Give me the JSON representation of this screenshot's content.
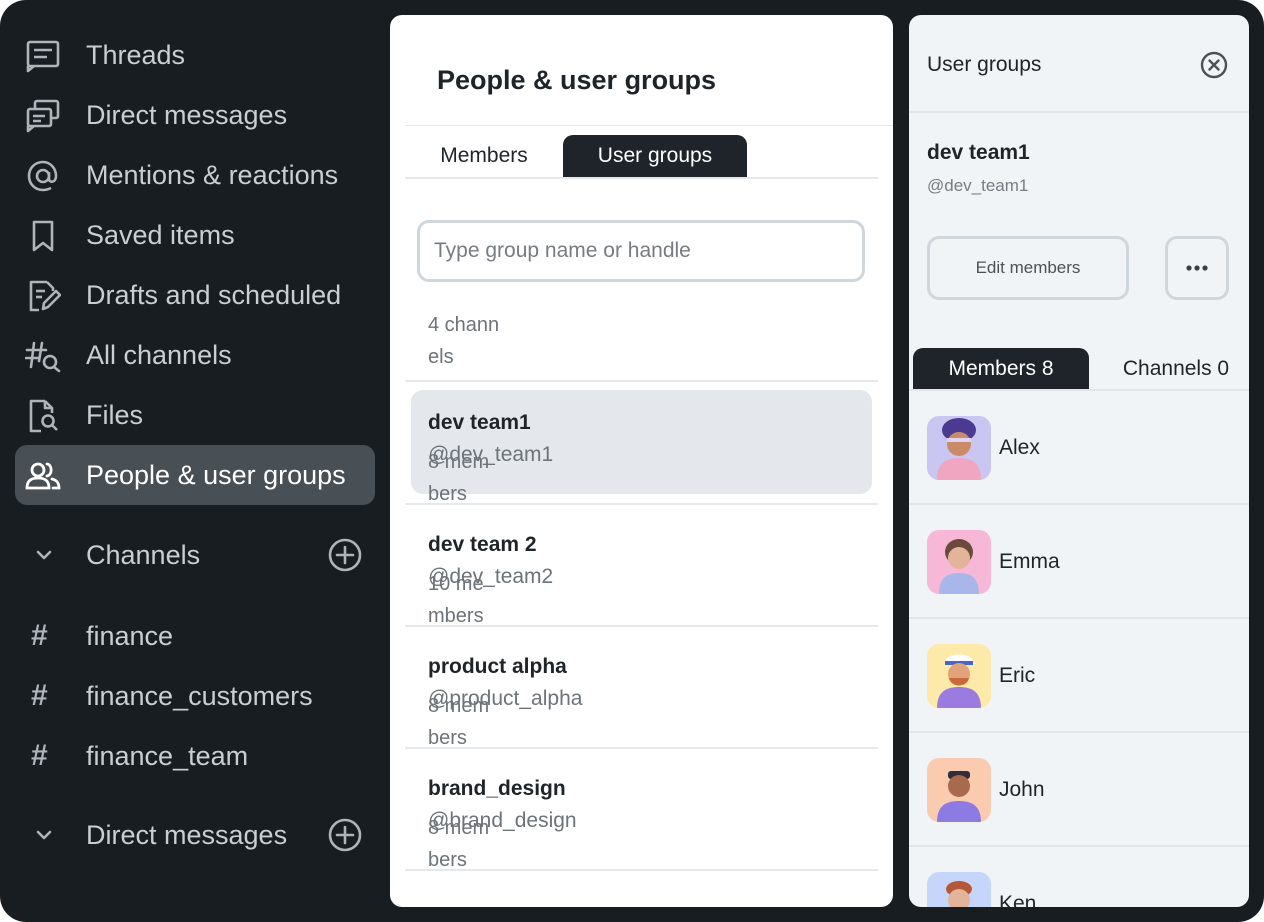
{
  "sidebar": {
    "nav": [
      {
        "label": "Threads",
        "icon": "threads-icon"
      },
      {
        "label": "Direct messages",
        "icon": "direct-messages-icon"
      },
      {
        "label": "Mentions & reactions",
        "icon": "at-sign-icon"
      },
      {
        "label": "Saved items",
        "icon": "bookmark-icon"
      },
      {
        "label": "Drafts and scheduled",
        "icon": "drafts-icon"
      },
      {
        "label": "All channels",
        "icon": "channel-search-icon"
      },
      {
        "label": "Files",
        "icon": "file-search-icon"
      },
      {
        "label": "People & user groups",
        "icon": "people-icon",
        "active": true
      }
    ],
    "channels_section": {
      "label": "Channels"
    },
    "channels": [
      {
        "label": "finance"
      },
      {
        "label": "finance_customers"
      },
      {
        "label": "finance_team"
      }
    ],
    "dm_section": {
      "label": "Direct messages"
    }
  },
  "middle": {
    "title": "People & user groups",
    "tabs": {
      "members": "Members",
      "user_groups": "User groups"
    },
    "search": {
      "placeholder": "Type group name or handle",
      "value": ""
    },
    "channels_count": "4 channels",
    "groups": [
      {
        "name": "dev team1",
        "handle": "@dev_team1",
        "members": "8 members",
        "selected": true
      },
      {
        "name": "dev team 2",
        "handle": "@dev_team2",
        "members": "10 members"
      },
      {
        "name": "product alpha",
        "handle": "@product_alpha",
        "members": "8 members"
      },
      {
        "name": "brand_design",
        "handle": "@brand_design",
        "members": "8 members"
      }
    ]
  },
  "right": {
    "title": "User groups",
    "group_name": "dev team1",
    "group_handle": "@dev_team1",
    "edit_label": "Edit members",
    "tabs": {
      "members": "Members 8",
      "channels": "Channels 0"
    },
    "members": [
      {
        "name": "Alex"
      },
      {
        "name": "Emma"
      },
      {
        "name": "Eric"
      },
      {
        "name": "John"
      },
      {
        "name": "Ken"
      }
    ]
  },
  "colors": {
    "sidebar_bg": "#171d21",
    "active_item_bg": "#484f55",
    "tab_active_bg": "#1e2429",
    "panel_bg": "#f1f4f7",
    "selected_row_bg": "#e4e8ec"
  }
}
